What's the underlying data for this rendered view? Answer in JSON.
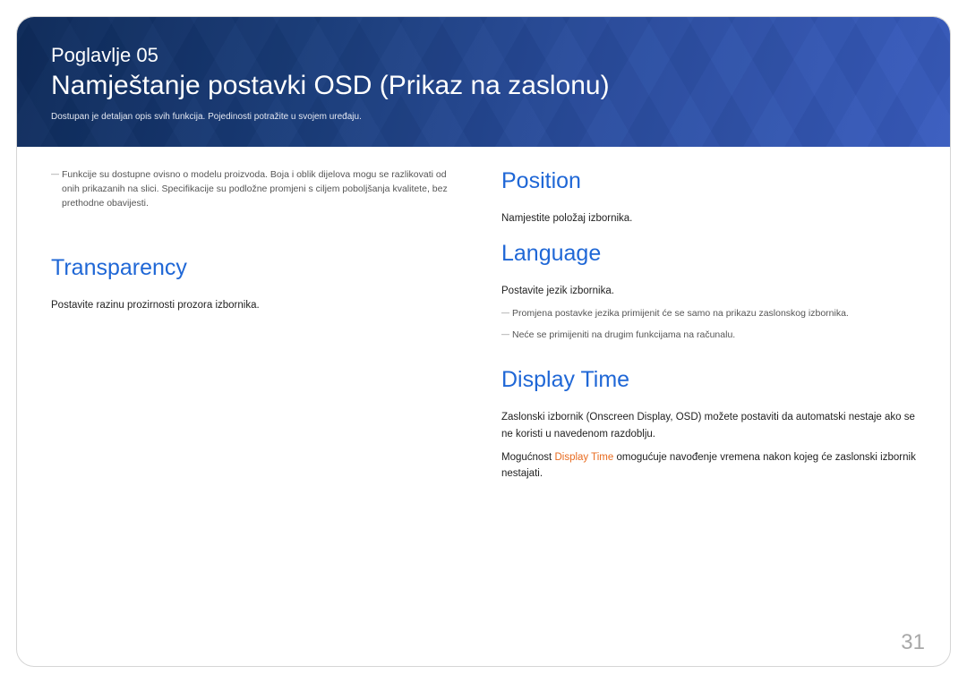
{
  "hero": {
    "chapter": "Poglavlje 05",
    "title": "Namještanje postavki OSD (Prikaz na zaslonu)",
    "subtitle": "Dostupan je detaljan opis svih funkcija. Pojedinosti potražite u svojem uređaju."
  },
  "left": {
    "top_note": "Funkcije su dostupne ovisno o modelu proizvoda. Boja i oblik dijelova mogu se razlikovati od onih prikazanih na slici. Specifikacije su podložne promjeni s ciljem poboljšanja kvalitete, bez prethodne obavijesti.",
    "transparency": {
      "heading": "Transparency",
      "body": "Postavite razinu prozirnosti prozora izbornika."
    }
  },
  "right": {
    "position": {
      "heading": "Position",
      "body": "Namjestite položaj izbornika."
    },
    "language": {
      "heading": "Language",
      "body": "Postavite jezik izbornika.",
      "note1": "Promjena postavke jezika primijenit će se samo na prikazu zaslonskog izbornika.",
      "note2": "Neće se primijeniti na drugim funkcijama na računalu."
    },
    "display_time": {
      "heading": "Display Time",
      "body1": "Zaslonski izbornik (Onscreen Display, OSD) možete postaviti da automatski nestaje ako se ne koristi u navedenom razdoblju.",
      "body2_prefix": "Mogućnost ",
      "body2_highlight": "Display Time",
      "body2_suffix": " omogućuje navođenje vremena nakon kojeg će zaslonski izbornik nestajati."
    }
  },
  "page_number": "31"
}
